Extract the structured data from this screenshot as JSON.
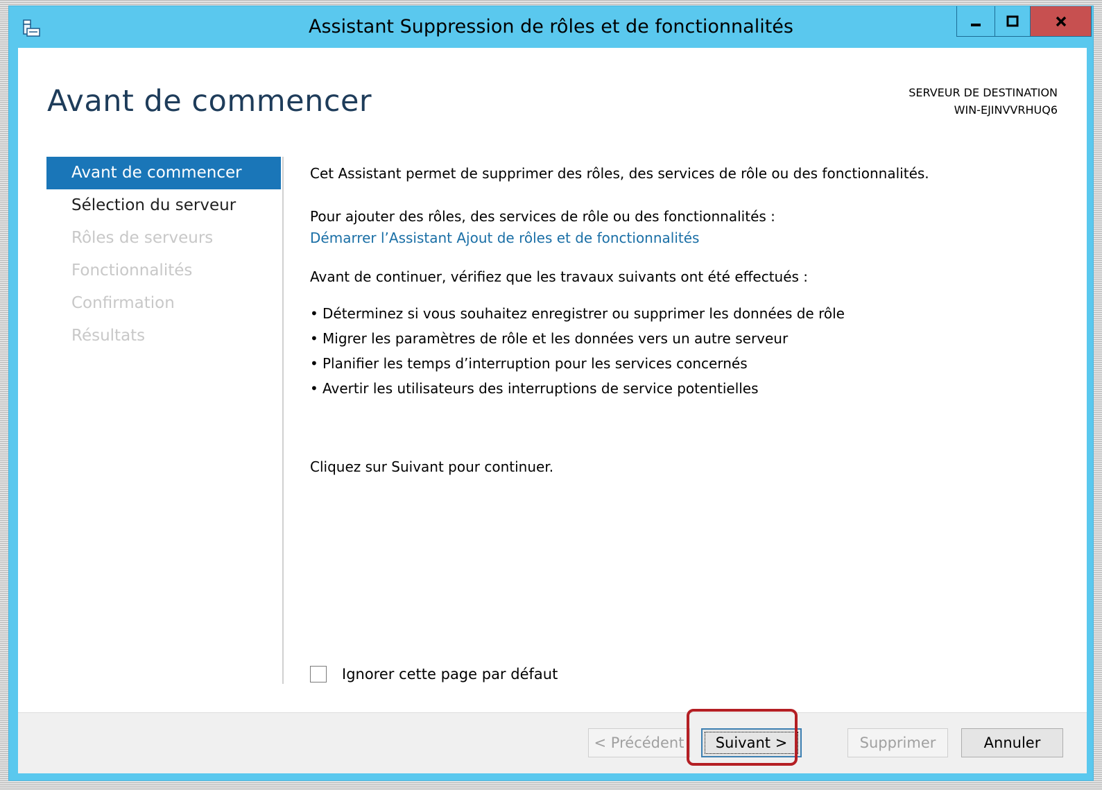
{
  "window": {
    "title": "Assistant Suppression de rôles et de fonctionnalités",
    "controls": {
      "minimize": "minimize",
      "maximize": "maximize",
      "close": "close"
    }
  },
  "header": {
    "page_title": "Avant de commencer",
    "destination_label": "SERVEUR DE DESTINATION",
    "destination_server": "WIN-EJINVVRHUQ6"
  },
  "nav": {
    "items": [
      {
        "label": "Avant de commencer",
        "state": "active"
      },
      {
        "label": "Sélection du serveur",
        "state": "enabled"
      },
      {
        "label": "Rôles de serveurs",
        "state": "disabled"
      },
      {
        "label": "Fonctionnalités",
        "state": "disabled"
      },
      {
        "label": "Confirmation",
        "state": "disabled"
      },
      {
        "label": "Résultats",
        "state": "disabled"
      }
    ]
  },
  "content": {
    "intro": "Cet Assistant permet de supprimer des rôles, des services de rôle ou des fonctionnalités.",
    "add_prompt": "Pour ajouter des rôles, des services de rôle ou des fonctionnalités :",
    "add_link": "Démarrer l’Assistant Ajout de rôles et de fonctionnalités",
    "check_prompt": "Avant de continuer, vérifiez que les travaux suivants ont été effectués :",
    "bullets": [
      "Déterminez si vous souhaitez enregistrer ou supprimer les données de rôle",
      "Migrer les paramètres de rôle et les données vers un autre serveur",
      "Planifier les temps d’interruption pour les services concernés",
      "Avertir les utilisateurs des interruptions de service potentielles"
    ],
    "continue_text": "Cliquez sur Suivant pour continuer."
  },
  "skip_checkbox": {
    "label": "Ignorer cette page par défaut",
    "checked": false
  },
  "footer": {
    "prev_label": "< Précédent",
    "next_label": "Suivant >",
    "delete_label": "Supprimer",
    "cancel_label": "Annuler"
  },
  "colors": {
    "frame": "#5ac8ee",
    "nav_active": "#1a76b8",
    "link": "#1a6fa6",
    "close_button": "#c75050",
    "highlight": "#b41f24"
  }
}
